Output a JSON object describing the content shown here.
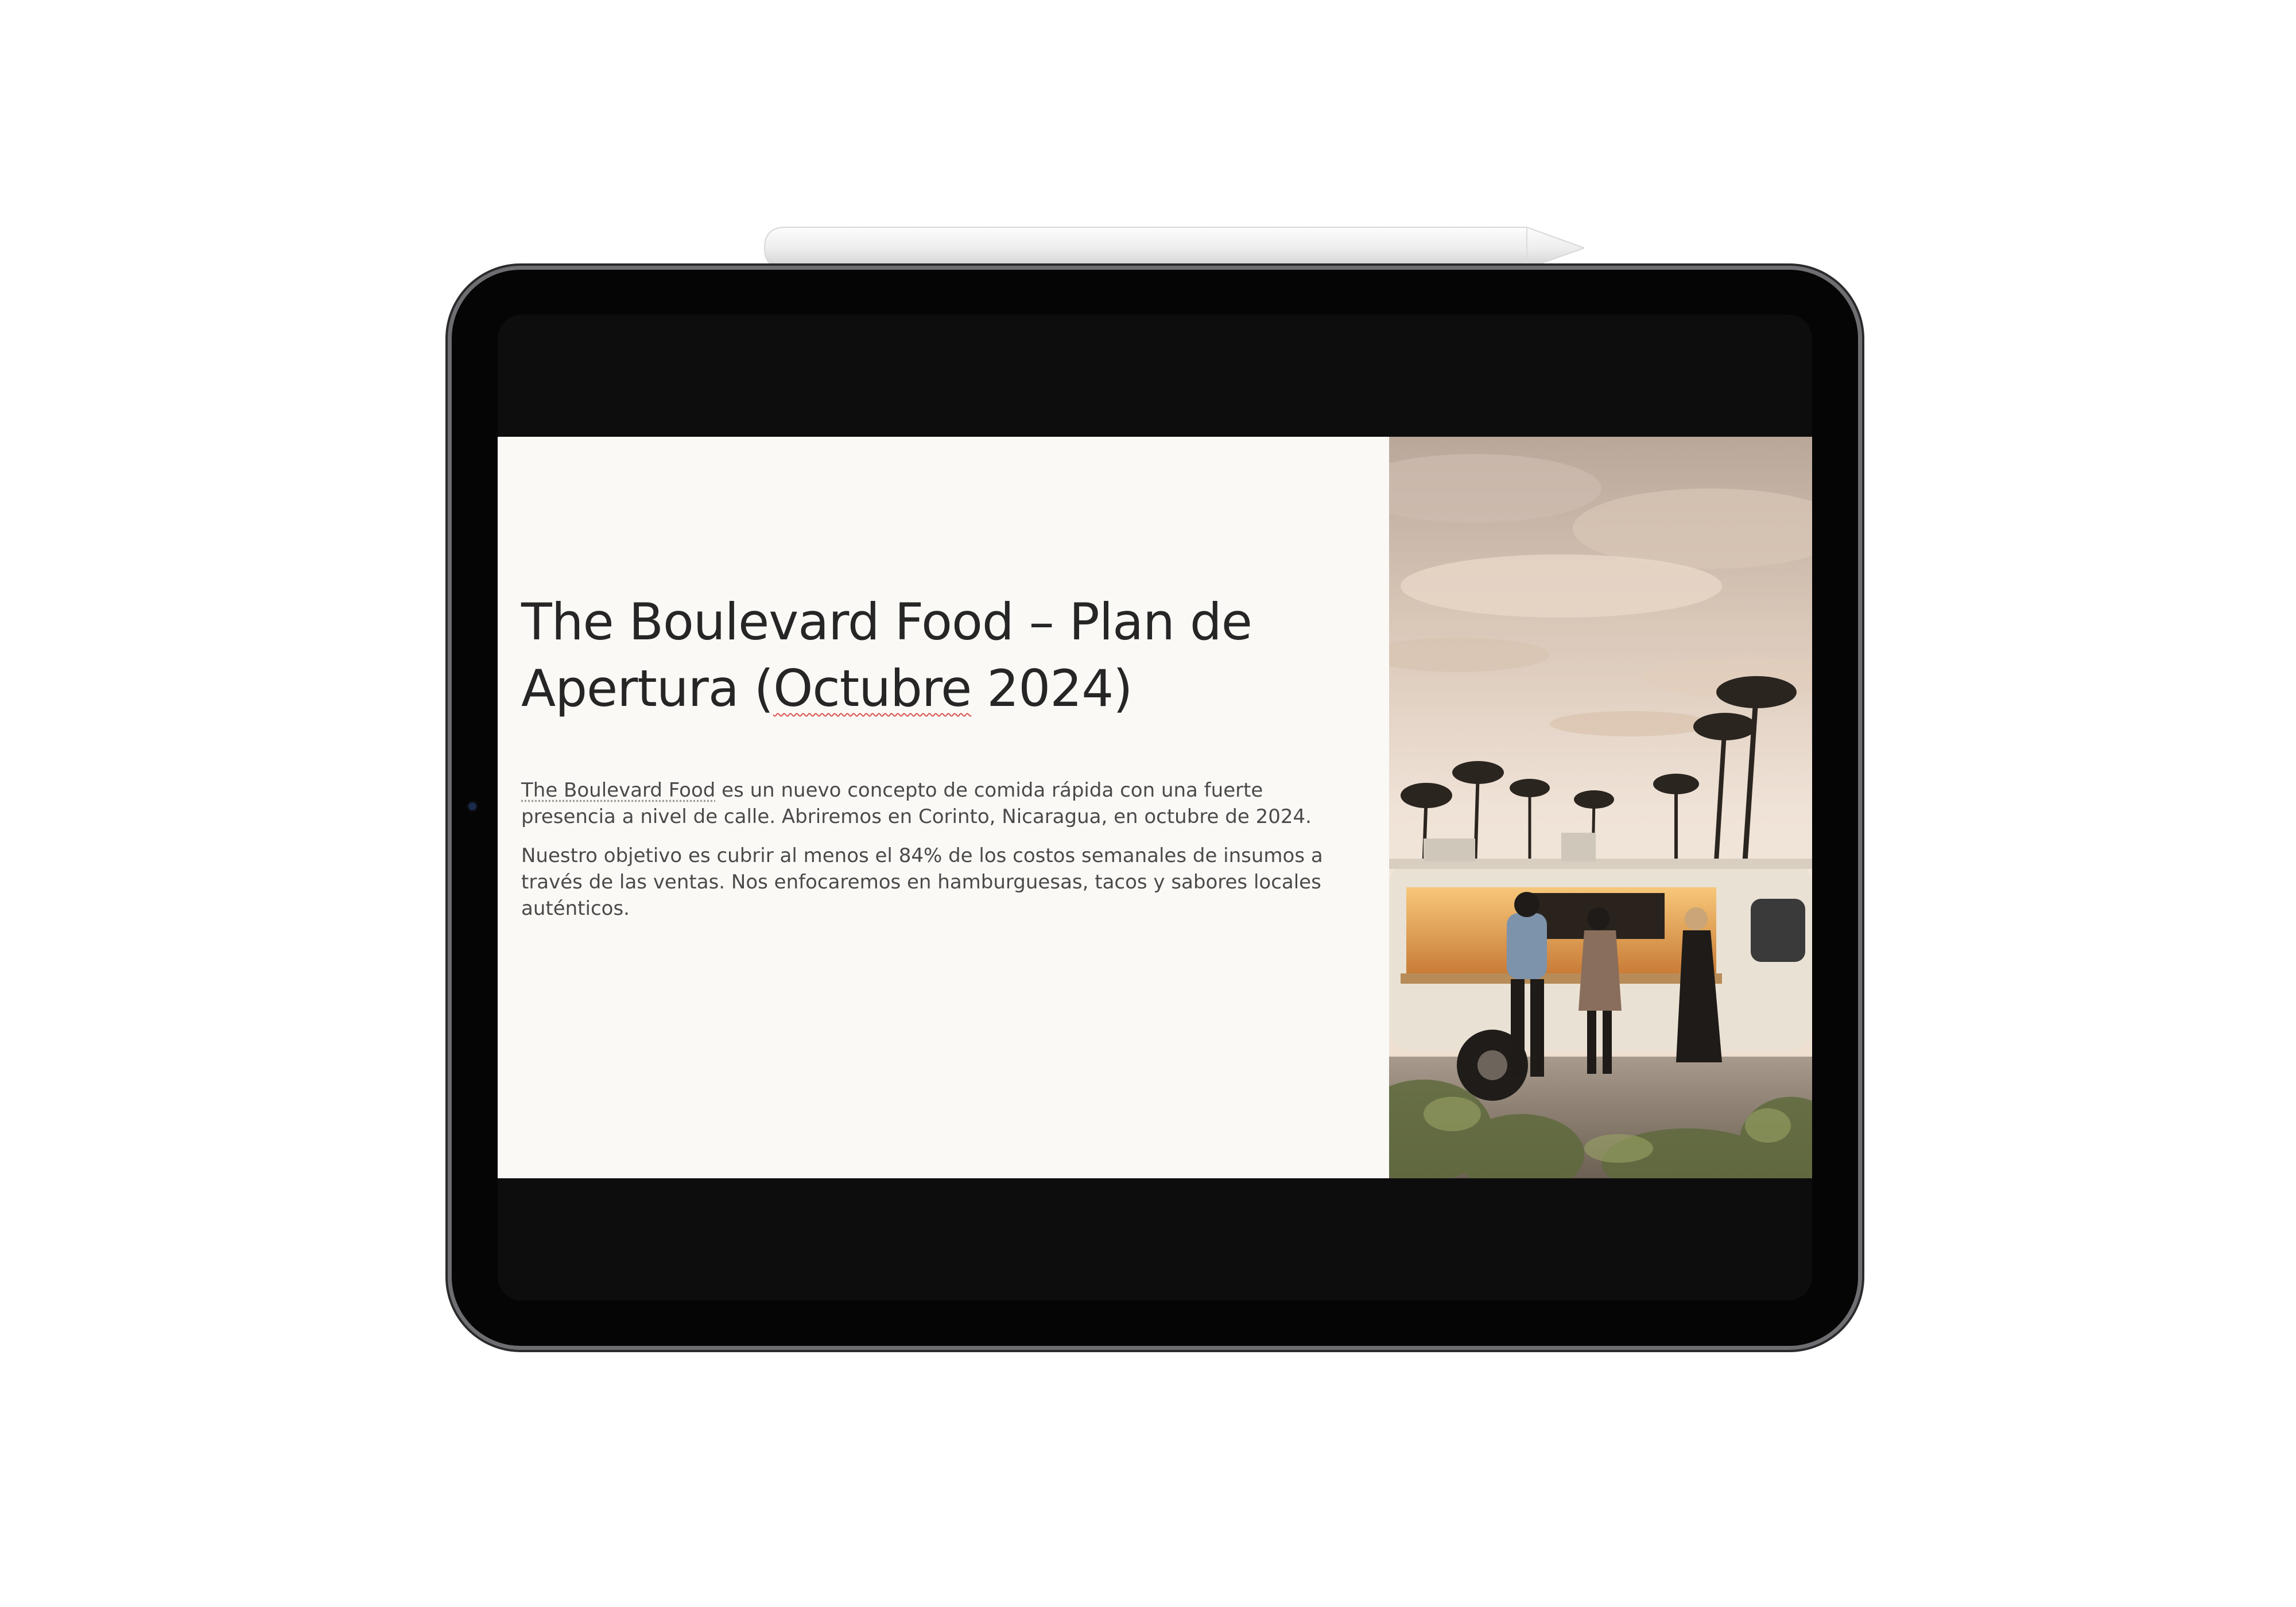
{
  "slide": {
    "title_part1": "The Boulevard Food – Plan de Apertura (",
    "title_misspelled": "Octubre",
    "title_part2": " 2024)",
    "paragraph1_brand": "The Boulevard Food",
    "paragraph1_rest": " es un nuevo concepto de comida rápida con una fuerte presencia a nivel de calle. Abriremos en Corinto, Nicaragua, en octubre de 2024.",
    "paragraph2": "Nuestro objetivo es cubrir al menos el 84% de los costos semanales de insumos a través de las ventas. Nos enfocaremos en hamburguesas, tacos y sabores locales auténticos."
  },
  "device": {
    "type": "tablet",
    "accessory": "stylus-pencil"
  },
  "colors": {
    "bezel": "#050505",
    "slide_background": "#fbf9f6",
    "title_text": "#262626",
    "body_text": "#4a4a4a",
    "spellcheck_underline": "#d9534f"
  }
}
